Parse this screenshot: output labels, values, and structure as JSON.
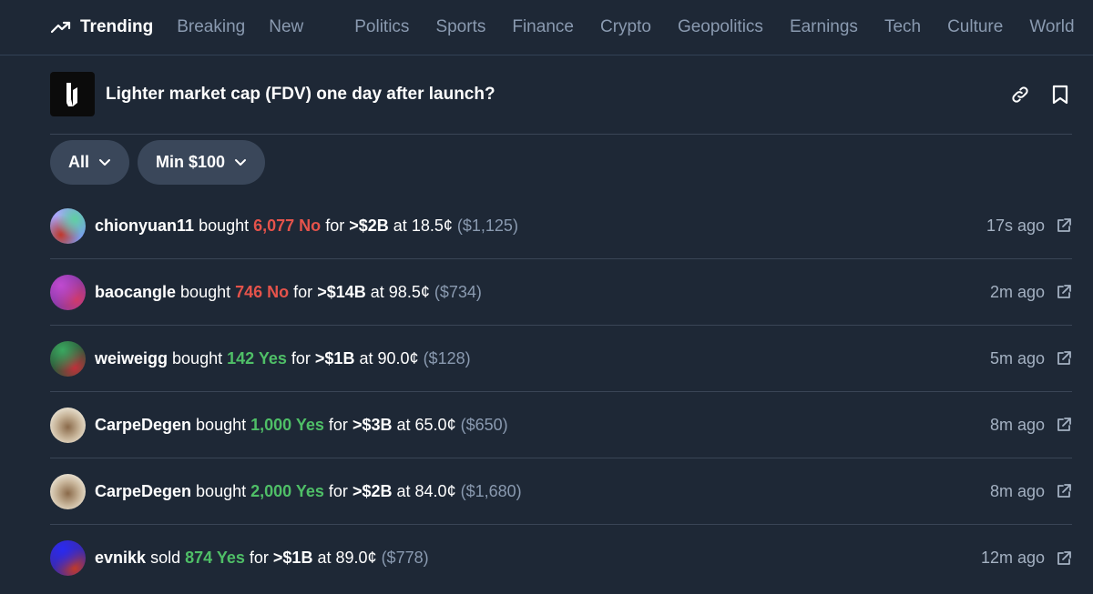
{
  "nav": {
    "primary": [
      {
        "label": "Trending",
        "active": true
      },
      {
        "label": "Breaking",
        "active": false
      },
      {
        "label": "New",
        "active": false
      }
    ],
    "categories": [
      "Politics",
      "Sports",
      "Finance",
      "Crypto",
      "Geopolitics",
      "Earnings",
      "Tech",
      "Culture",
      "World"
    ]
  },
  "market": {
    "title": "Lighter market cap (FDV) one day after launch?",
    "logo_icon": "lighter-logo",
    "actions": [
      "link-icon",
      "bookmark-icon"
    ]
  },
  "filters": {
    "side": "All",
    "min_amount": "Min $100"
  },
  "colors": {
    "background": "#1e2836",
    "no": "#e5534b",
    "yes": "#4fbf67",
    "muted": "#8a9ab0",
    "pill": "#3a475a"
  },
  "trades": [
    {
      "user": "chionyuan11",
      "action": "bought",
      "qty": "6,077 No",
      "side": "no",
      "for_word": "for",
      "outcome": ">$2B",
      "at_word": "at",
      "price": "18.5¢",
      "total": "($1,125)",
      "time": "17s ago"
    },
    {
      "user": "baocangle",
      "action": "bought",
      "qty": "746 No",
      "side": "no",
      "for_word": "for",
      "outcome": ">$14B",
      "at_word": "at",
      "price": "98.5¢",
      "total": "($734)",
      "time": "2m ago"
    },
    {
      "user": "weiweigg",
      "action": "bought",
      "qty": "142 Yes",
      "side": "yes",
      "for_word": "for",
      "outcome": ">$1B",
      "at_word": "at",
      "price": "90.0¢",
      "total": "($128)",
      "time": "5m ago"
    },
    {
      "user": "CarpeDegen",
      "action": "bought",
      "qty": "1,000 Yes",
      "side": "yes",
      "for_word": "for",
      "outcome": ">$3B",
      "at_word": "at",
      "price": "65.0¢",
      "total": "($650)",
      "time": "8m ago"
    },
    {
      "user": "CarpeDegen",
      "action": "bought",
      "qty": "2,000 Yes",
      "side": "yes",
      "for_word": "for",
      "outcome": ">$2B",
      "at_word": "at",
      "price": "84.0¢",
      "total": "($1,680)",
      "time": "8m ago"
    },
    {
      "user": "evnikk",
      "action": "sold",
      "qty": "874 Yes",
      "side": "yes",
      "for_word": "for",
      "outcome": ">$1B",
      "at_word": "at",
      "price": "89.0¢",
      "total": "($778)",
      "time": "12m ago"
    }
  ]
}
